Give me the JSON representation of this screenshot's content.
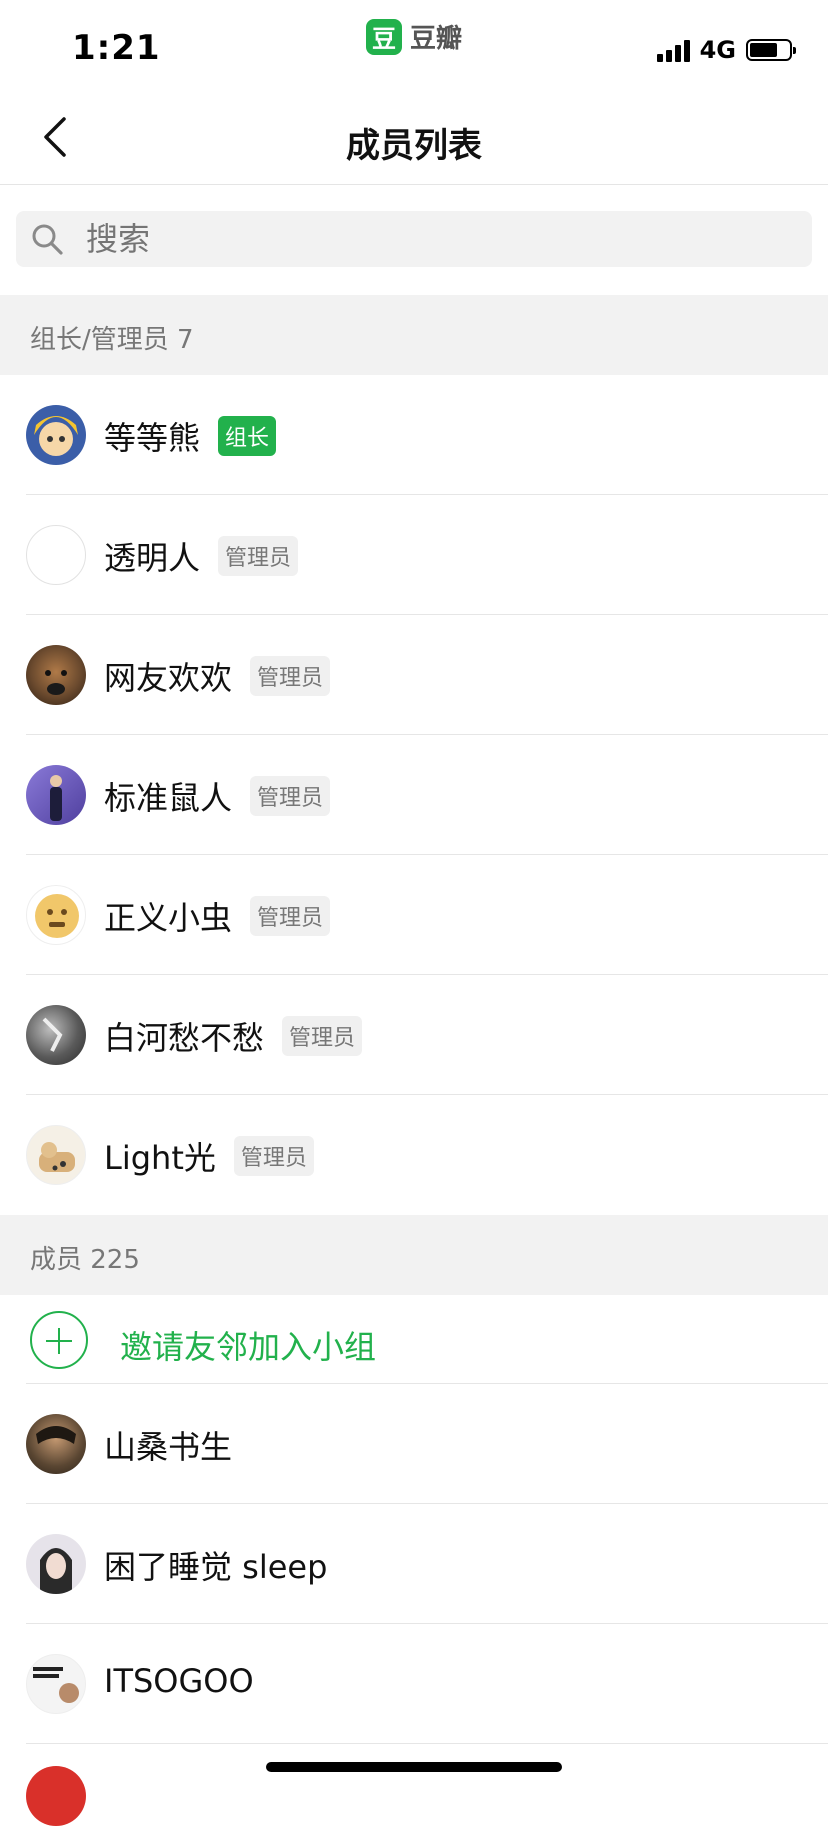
{
  "status_bar": {
    "time": "1:21",
    "app_logo_char": "豆",
    "app_name": "豆瓣",
    "network": "4G"
  },
  "nav": {
    "title": "成员列表",
    "back_icon": "chevron-left-icon"
  },
  "search": {
    "placeholder": "搜索",
    "icon": "search-icon"
  },
  "admins_section": {
    "label": "组长/管理员 7"
  },
  "admins": [
    {
      "name": "等等熊",
      "badge": "组长",
      "role": "leader",
      "avatar_color": "#3b5ea8"
    },
    {
      "name": "透明人",
      "badge": "管理员",
      "role": "admin",
      "avatar_color": "#ffffff"
    },
    {
      "name": "网友欢欢",
      "badge": "管理员",
      "role": "admin",
      "avatar_color": "#6b4a2e"
    },
    {
      "name": "标准鼠人",
      "badge": "管理员",
      "role": "admin",
      "avatar_color": "#6f5cc4"
    },
    {
      "name": "正义小虫",
      "badge": "管理员",
      "role": "admin",
      "avatar_color": "#e9b24a"
    },
    {
      "name": "白河愁不愁",
      "badge": "管理员",
      "role": "admin",
      "avatar_color": "#555555"
    },
    {
      "name": "Light光",
      "badge": "管理员",
      "role": "admin",
      "avatar_color": "#d9c9a8"
    }
  ],
  "members_section": {
    "label": "成员 225"
  },
  "invite": {
    "label": "邀请友邻加入小组",
    "icon": "plus-circle-icon"
  },
  "members": [
    {
      "name": "山桑书生",
      "avatar_color": "#5a4632"
    },
    {
      "name": "困了睡觉 sleep",
      "avatar_color": "#c9c4cf"
    },
    {
      "name": "ITSOGOO",
      "avatar_color": "#8a8a8a"
    }
  ],
  "colors": {
    "brand_green": "#22b14c",
    "section_bg": "#f2f2f2"
  }
}
